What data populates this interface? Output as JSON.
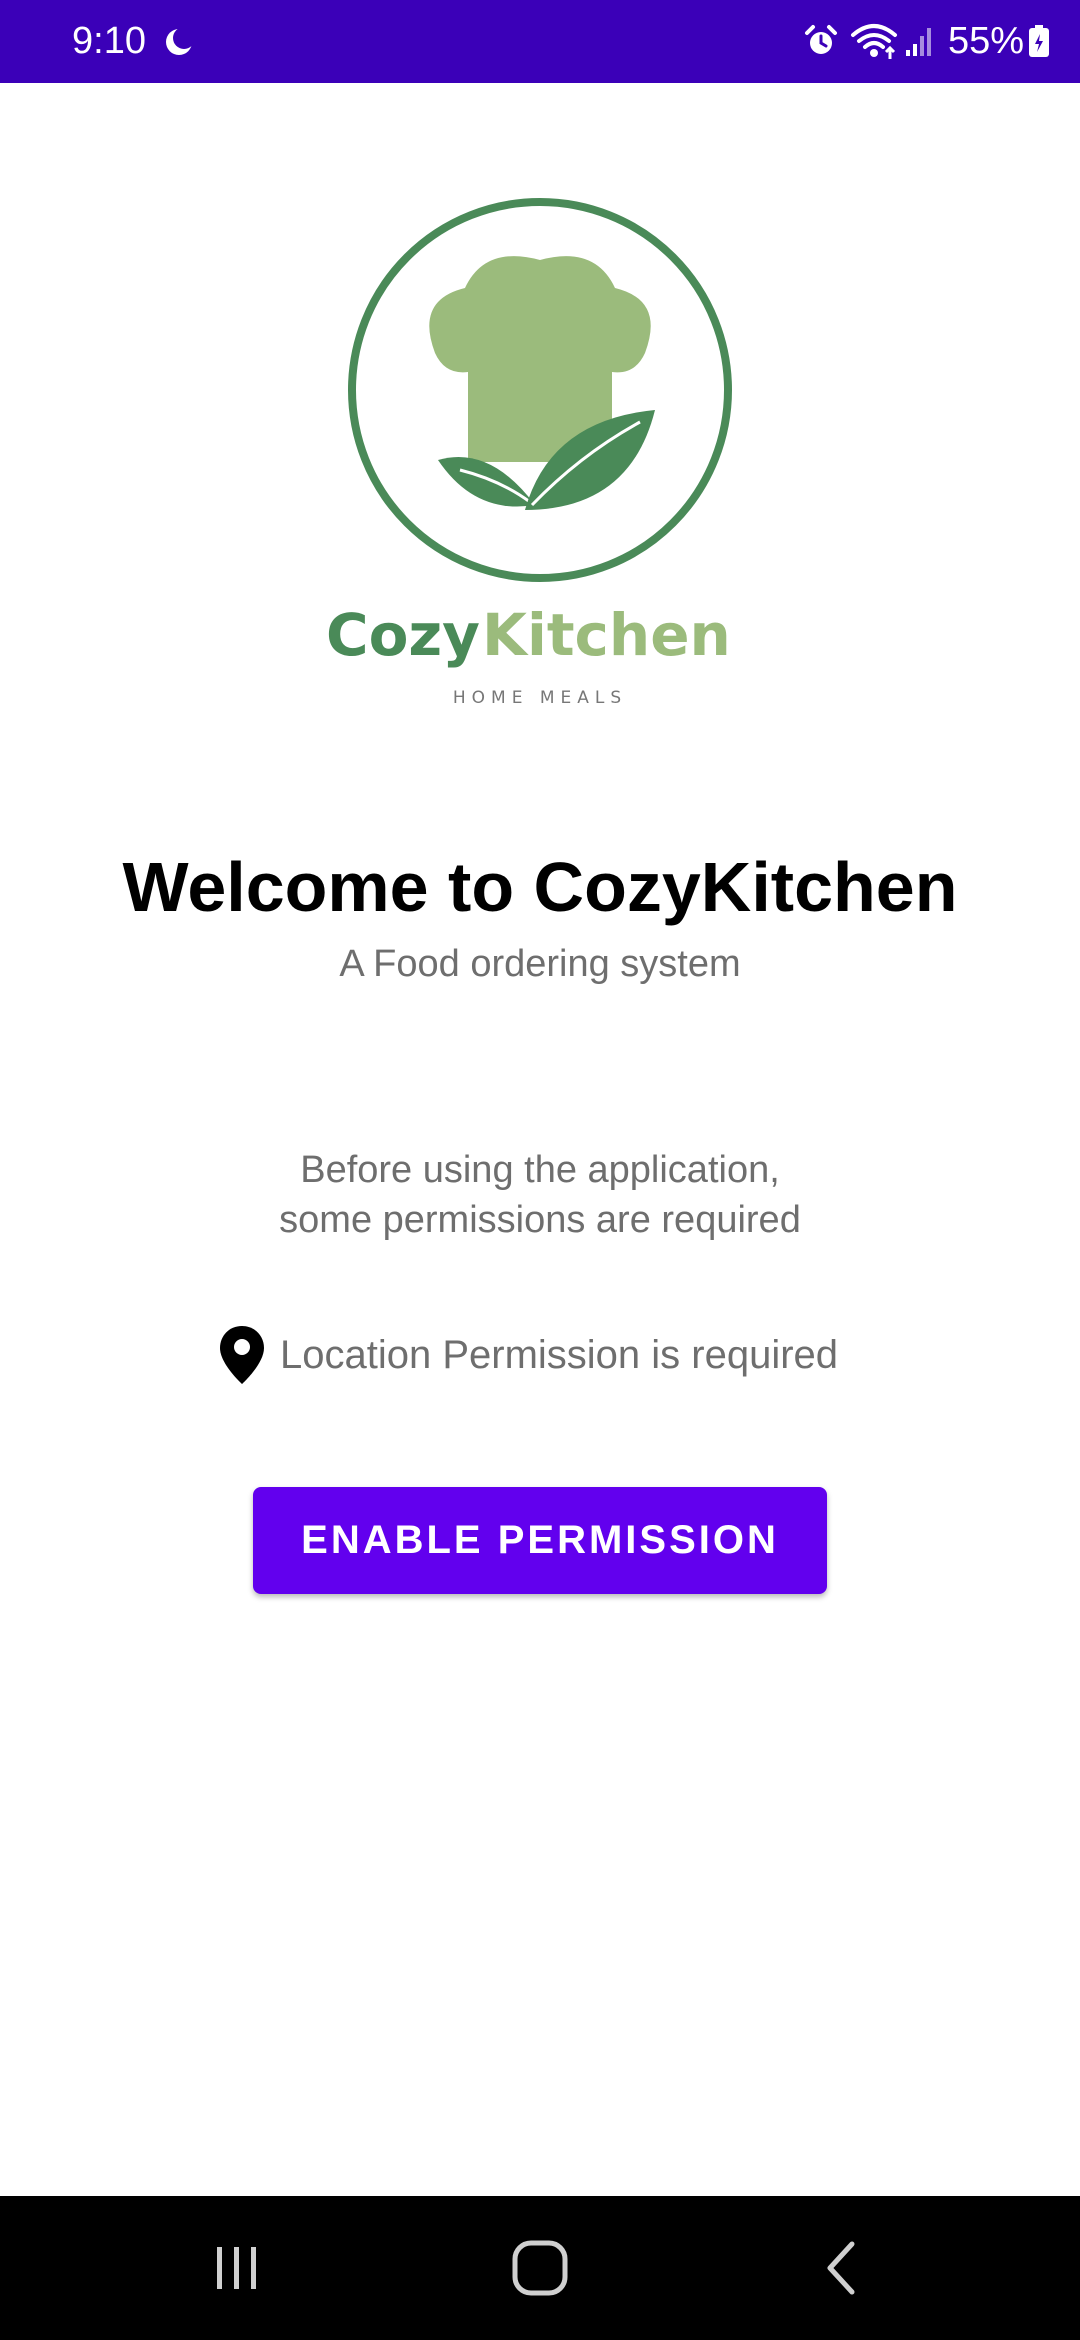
{
  "status_bar": {
    "time": "9:10",
    "battery_percent": "55%",
    "background_color": "#3b00b8",
    "icons": [
      "moon-icon",
      "alarm-icon",
      "wifi-icon",
      "signal-icon",
      "battery-charging-icon"
    ]
  },
  "logo": {
    "word_cozy": "Cozy",
    "word_kitchen": "Kitchen",
    "tagline": "HOME MEALS",
    "colors": {
      "dark_green": "#4a8a58",
      "light_green": "#9bbb7c"
    }
  },
  "welcome": {
    "title": "Welcome to CozyKitchen",
    "subtitle": "A Food ordering system"
  },
  "permissions": {
    "intro_line1": "Before using the application,",
    "intro_line2": "some permissions are required",
    "location_text": "Location Permission is required",
    "location_icon": "location-pin-icon"
  },
  "button": {
    "label": "ENABLE PERMISSION",
    "color": "#6200ee"
  },
  "nav_bar": {
    "items": [
      "recent-apps-icon",
      "home-icon",
      "back-icon"
    ]
  }
}
